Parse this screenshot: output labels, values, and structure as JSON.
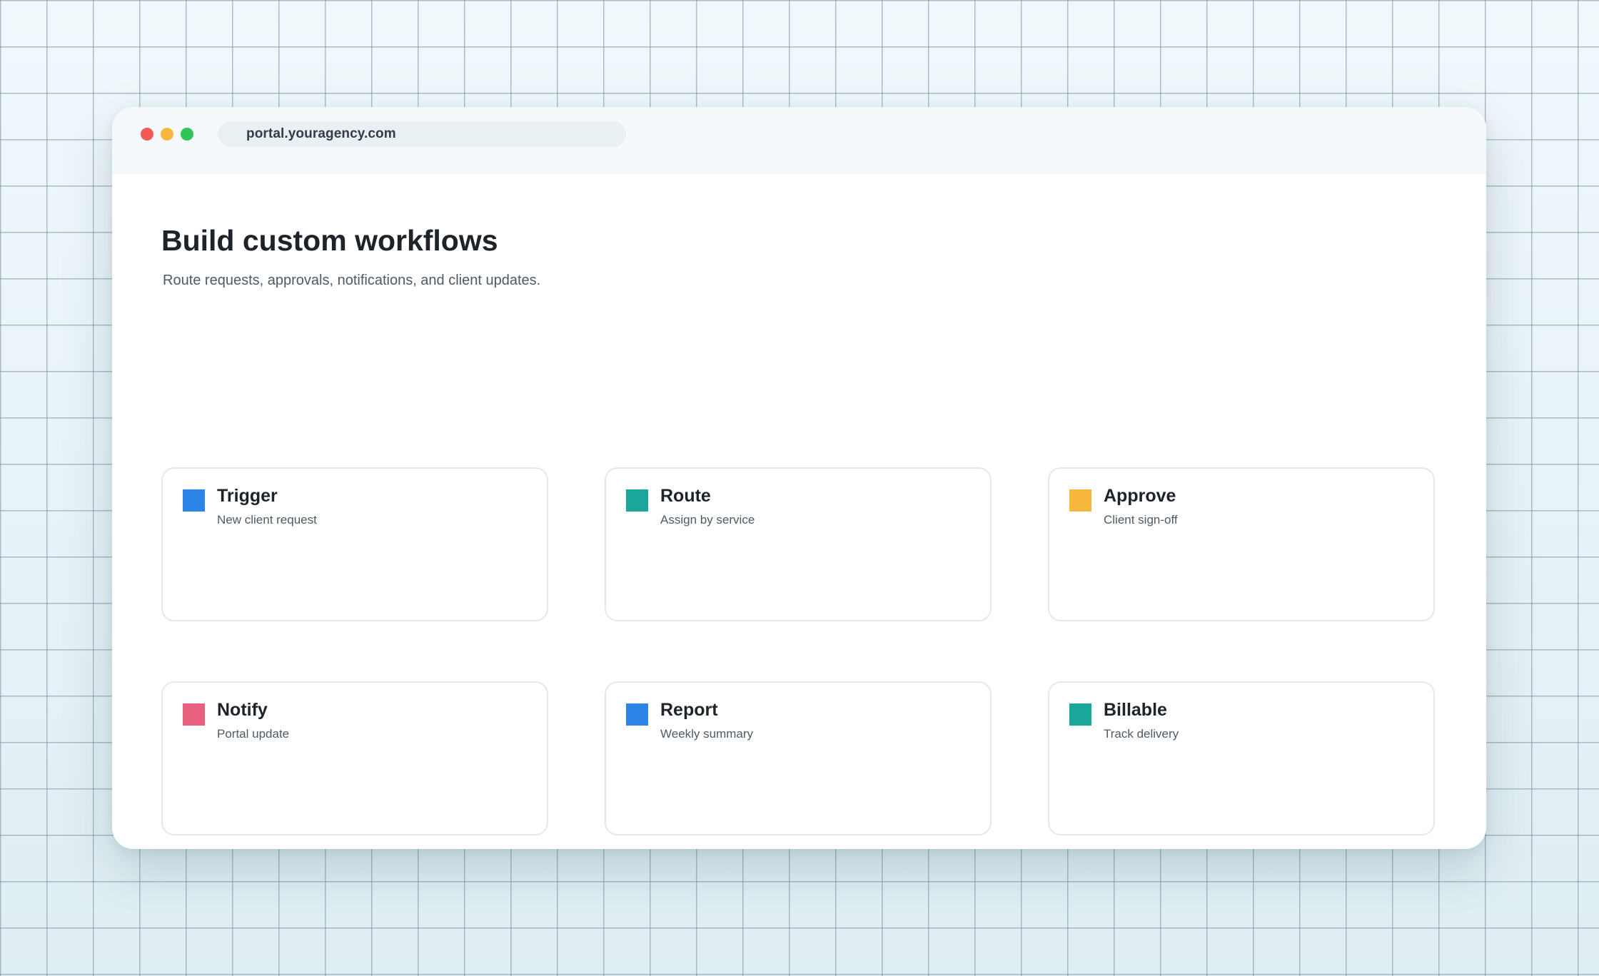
{
  "browser": {
    "url": "portal.youragency.com"
  },
  "page": {
    "title": "Build custom workflows",
    "subtitle": "Route requests, approvals, notifications, and client updates."
  },
  "cards": [
    {
      "title": "Trigger",
      "subtitle": "New client request",
      "color": "#2b84e6"
    },
    {
      "title": "Route",
      "subtitle": "Assign by service",
      "color": "#1aa69a"
    },
    {
      "title": "Approve",
      "subtitle": "Client sign-off",
      "color": "#f6b73c"
    },
    {
      "title": "Notify",
      "subtitle": "Portal update",
      "color": "#e8607e"
    },
    {
      "title": "Report",
      "subtitle": "Weekly summary",
      "color": "#2b84e6"
    },
    {
      "title": "Billable",
      "subtitle": "Track delivery",
      "color": "#1aa69a"
    }
  ]
}
